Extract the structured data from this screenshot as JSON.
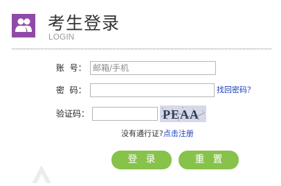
{
  "header": {
    "title": "考生登录",
    "subtitle": "LOGIN",
    "icon": "users-icon",
    "icon_color": "#8f4aa7"
  },
  "form": {
    "account_label": "账  号：",
    "account_placeholder": "邮箱/手机",
    "password_label": "密  码：",
    "password_value": "",
    "forgot_link": "找回密码？",
    "captcha_label": "验证码：",
    "captcha_value": "",
    "captcha_text": "PEAA"
  },
  "register": {
    "prompt": "没有通行证?",
    "link": "点击注册"
  },
  "buttons": {
    "login": "登录",
    "reset": "重置",
    "color": "#87c24b"
  }
}
